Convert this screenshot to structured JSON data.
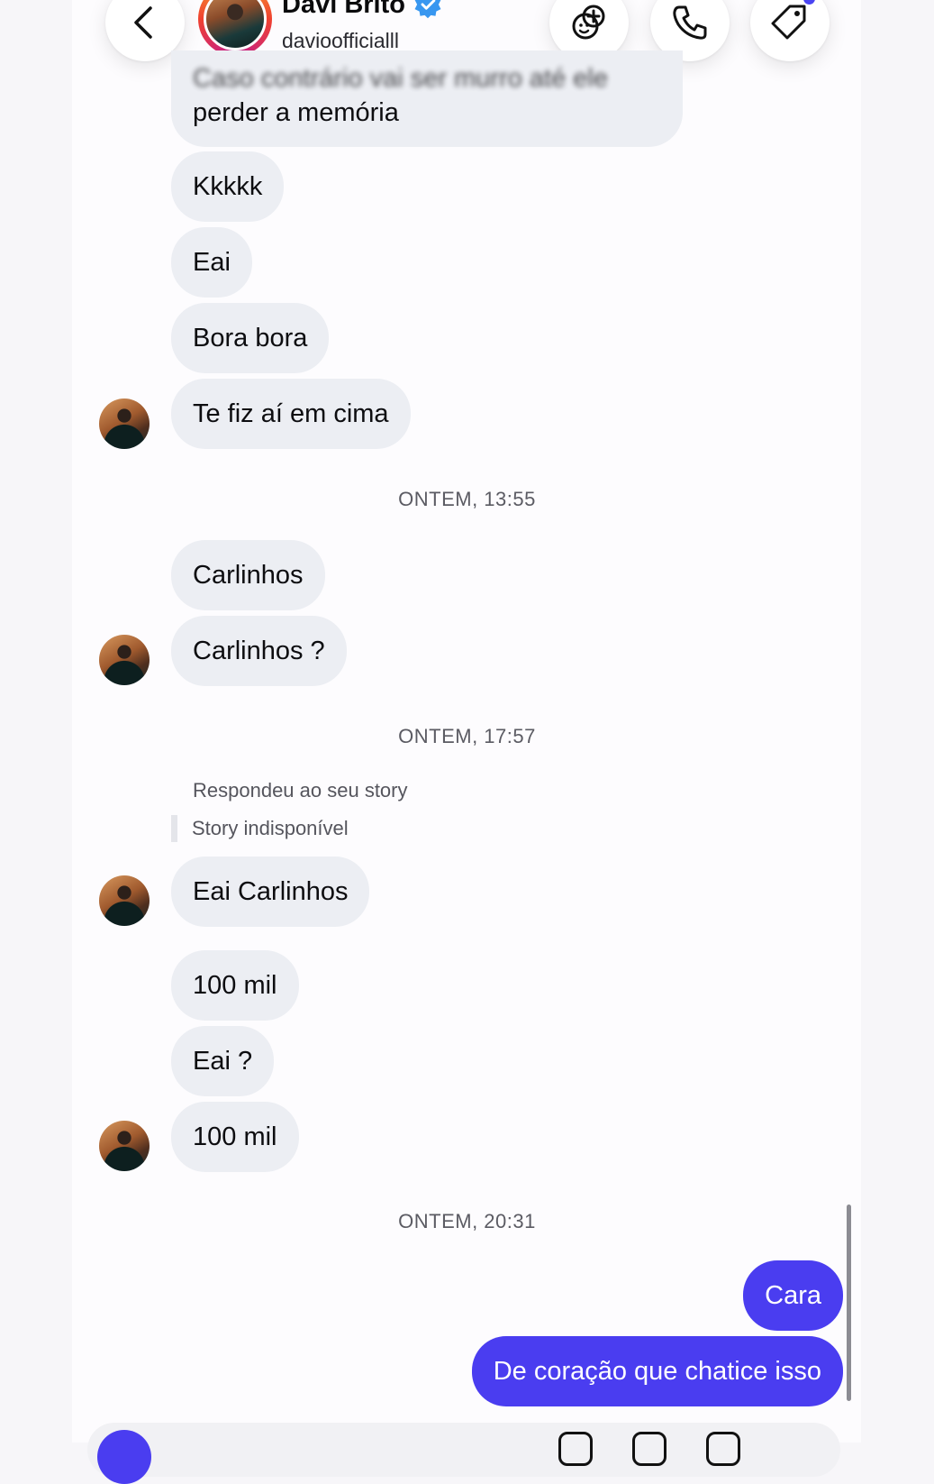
{
  "header": {
    "name": "Davi Brito",
    "handle": "davioofficialll",
    "verified": true,
    "accent_color": "#4a3df0",
    "icons": [
      "back-icon",
      "effects-icon",
      "phone-icon",
      "tag-icon"
    ]
  },
  "messages": {
    "m0_line1": "Caso contrário vai ser murro até ele",
    "m0_line2": "perder a memória",
    "m1": "Kkkkk",
    "m2": "Eai",
    "m3": "Bora bora",
    "m4": "Te fiz aí em cima",
    "sep1": "ONTEM, 13:55",
    "m5": "Carlinhos",
    "m6": "Carlinhos ?",
    "sep2": "ONTEM, 17:57",
    "reply_label": "Respondeu ao seu story",
    "reply_quote": "Story indisponível",
    "m7": "Eai Carlinhos",
    "m8": "100 mil",
    "m9": "Eai ?",
    "m10": "100 mil",
    "sep3": "ONTEM, 20:31",
    "out1": "Cara",
    "out2": "De coração que chatice isso"
  }
}
